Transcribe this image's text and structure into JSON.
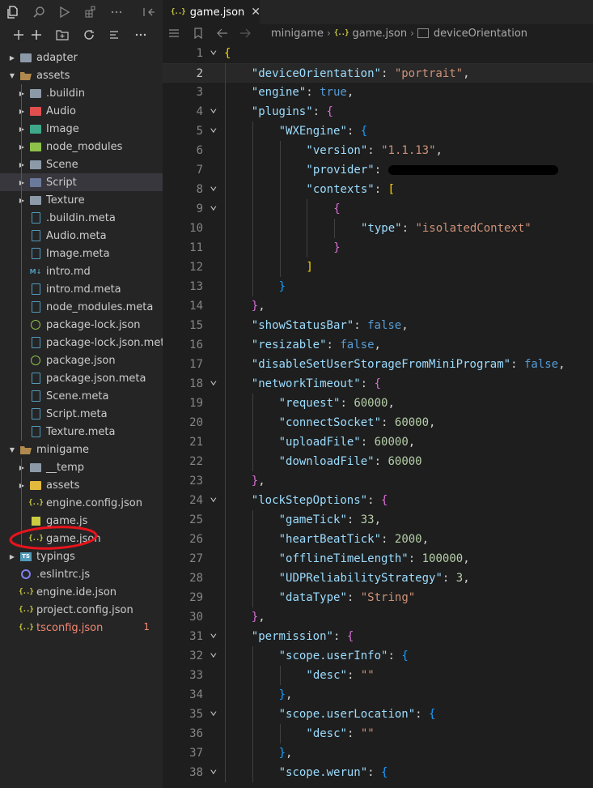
{
  "sidebar": {
    "toolbar_icons": [
      "explorer-icon",
      "search-icon",
      "debug-icon",
      "extensions-icon",
      "more-icon",
      "collapse-panel-icon"
    ],
    "action_icons": [
      "new-file-icon",
      "new-folder-icon",
      "refresh-icon",
      "collapse-all-icon",
      "more-icon"
    ],
    "tree": [
      {
        "label": "adapter",
        "type": "folder",
        "depth": 0,
        "expanded": false
      },
      {
        "label": "assets",
        "type": "folder-open",
        "depth": 0,
        "expanded": true
      },
      {
        "label": ".buildin",
        "type": "folder",
        "depth": 1,
        "expanded": false
      },
      {
        "label": "Audio",
        "type": "folder-audio",
        "depth": 1,
        "expanded": false
      },
      {
        "label": "Image",
        "type": "folder-image",
        "depth": 1,
        "expanded": false
      },
      {
        "label": "node_modules",
        "type": "folder-node",
        "depth": 1,
        "expanded": false
      },
      {
        "label": "Scene",
        "type": "folder",
        "depth": 1,
        "expanded": false
      },
      {
        "label": "Script",
        "type": "folder-script",
        "depth": 1,
        "expanded": false,
        "selected": true
      },
      {
        "label": "Texture",
        "type": "folder",
        "depth": 1,
        "expanded": false
      },
      {
        "label": ".buildin.meta",
        "type": "file",
        "depth": 1
      },
      {
        "label": "Audio.meta",
        "type": "file",
        "depth": 1
      },
      {
        "label": "Image.meta",
        "type": "file",
        "depth": 1
      },
      {
        "label": "intro.md",
        "type": "md",
        "depth": 1
      },
      {
        "label": "intro.md.meta",
        "type": "file",
        "depth": 1
      },
      {
        "label": "node_modules.meta",
        "type": "file",
        "depth": 1
      },
      {
        "label": "package-lock.json",
        "type": "node",
        "depth": 1
      },
      {
        "label": "package-lock.json.meta",
        "type": "file",
        "depth": 1
      },
      {
        "label": "package.json",
        "type": "node",
        "depth": 1
      },
      {
        "label": "package.json.meta",
        "type": "file",
        "depth": 1
      },
      {
        "label": "Scene.meta",
        "type": "file",
        "depth": 1
      },
      {
        "label": "Script.meta",
        "type": "file",
        "depth": 1
      },
      {
        "label": "Texture.meta",
        "type": "file",
        "depth": 1
      },
      {
        "label": "minigame",
        "type": "folder-open",
        "depth": 0,
        "expanded": true
      },
      {
        "label": "__temp",
        "type": "folder",
        "depth": 1,
        "expanded": false
      },
      {
        "label": "assets",
        "type": "folder-assets",
        "depth": 1,
        "expanded": false
      },
      {
        "label": "engine.config.json",
        "type": "json",
        "depth": 1
      },
      {
        "label": "game.js",
        "type": "js",
        "depth": 1
      },
      {
        "label": "game.json",
        "type": "json",
        "depth": 1,
        "annotated": true
      },
      {
        "label": "typings",
        "type": "folder-ts",
        "depth": 0,
        "expanded": false
      },
      {
        "label": ".eslintrc.js",
        "type": "eslint",
        "depth": 0
      },
      {
        "label": "engine.ide.json",
        "type": "json",
        "depth": 0
      },
      {
        "label": "project.config.json",
        "type": "json",
        "depth": 0
      },
      {
        "label": "tsconfig.json",
        "type": "json",
        "depth": 0,
        "error": true,
        "badge": "1"
      }
    ]
  },
  "editor": {
    "tab": {
      "icon": "{..}",
      "label": "game.json",
      "close": "✕"
    },
    "breadcrumbs": {
      "folder": "minigame",
      "file_icon": "{..}",
      "file": "game.json",
      "symbol": "deviceOrientation"
    },
    "current_line": 2,
    "lines": [
      {
        "n": "1",
        "fold": true,
        "indent": 0,
        "tokens": [
          {
            "t": "{",
            "c": "br1"
          }
        ]
      },
      {
        "n": "2",
        "indent": 1,
        "tokens": [
          {
            "t": "\"deviceOrientation\"",
            "c": "k"
          },
          {
            "t": ": ",
            "c": "p"
          },
          {
            "t": "\"portrait\"",
            "c": "s"
          },
          {
            "t": ",",
            "c": "p"
          }
        ]
      },
      {
        "n": "3",
        "indent": 1,
        "tokens": [
          {
            "t": "\"engine\"",
            "c": "k"
          },
          {
            "t": ": ",
            "c": "p"
          },
          {
            "t": "true",
            "c": "b"
          },
          {
            "t": ",",
            "c": "p"
          }
        ]
      },
      {
        "n": "4",
        "fold": true,
        "indent": 1,
        "tokens": [
          {
            "t": "\"plugins\"",
            "c": "k"
          },
          {
            "t": ": ",
            "c": "p"
          },
          {
            "t": "{",
            "c": "br2"
          }
        ]
      },
      {
        "n": "5",
        "fold": true,
        "indent": 2,
        "tokens": [
          {
            "t": "\"WXEngine\"",
            "c": "k"
          },
          {
            "t": ": ",
            "c": "p"
          },
          {
            "t": "{",
            "c": "br3"
          }
        ]
      },
      {
        "n": "6",
        "indent": 3,
        "tokens": [
          {
            "t": "\"version\"",
            "c": "k"
          },
          {
            "t": ": ",
            "c": "p"
          },
          {
            "t": "\"1.1.13\"",
            "c": "s"
          },
          {
            "t": ",",
            "c": "p"
          }
        ]
      },
      {
        "n": "7",
        "indent": 3,
        "tokens": [
          {
            "t": "\"provider\"",
            "c": "k"
          },
          {
            "t": ": ",
            "c": "p"
          },
          {
            "t": "",
            "c": "redact"
          }
        ]
      },
      {
        "n": "8",
        "fold": true,
        "indent": 3,
        "tokens": [
          {
            "t": "\"contexts\"",
            "c": "k"
          },
          {
            "t": ": ",
            "c": "p"
          },
          {
            "t": "[",
            "c": "br1"
          }
        ]
      },
      {
        "n": "9",
        "fold": true,
        "indent": 4,
        "tokens": [
          {
            "t": "{",
            "c": "br2"
          }
        ]
      },
      {
        "n": "10",
        "indent": 5,
        "tokens": [
          {
            "t": "\"type\"",
            "c": "k"
          },
          {
            "t": ": ",
            "c": "p"
          },
          {
            "t": "\"isolatedContext\"",
            "c": "s"
          }
        ]
      },
      {
        "n": "11",
        "indent": 4,
        "tokens": [
          {
            "t": "}",
            "c": "br2"
          }
        ]
      },
      {
        "n": "12",
        "indent": 3,
        "tokens": [
          {
            "t": "]",
            "c": "br1"
          }
        ]
      },
      {
        "n": "13",
        "indent": 2,
        "tokens": [
          {
            "t": "}",
            "c": "br3"
          }
        ]
      },
      {
        "n": "14",
        "indent": 1,
        "tokens": [
          {
            "t": "}",
            "c": "br2"
          },
          {
            "t": ",",
            "c": "p"
          }
        ]
      },
      {
        "n": "15",
        "indent": 1,
        "tokens": [
          {
            "t": "\"showStatusBar\"",
            "c": "k"
          },
          {
            "t": ": ",
            "c": "p"
          },
          {
            "t": "false",
            "c": "b"
          },
          {
            "t": ",",
            "c": "p"
          }
        ]
      },
      {
        "n": "16",
        "indent": 1,
        "tokens": [
          {
            "t": "\"resizable\"",
            "c": "k"
          },
          {
            "t": ": ",
            "c": "p"
          },
          {
            "t": "false",
            "c": "b"
          },
          {
            "t": ",",
            "c": "p"
          }
        ]
      },
      {
        "n": "17",
        "indent": 1,
        "tokens": [
          {
            "t": "\"disableSetUserStorageFromMiniProgram\"",
            "c": "k"
          },
          {
            "t": ": ",
            "c": "p"
          },
          {
            "t": "false",
            "c": "b"
          },
          {
            "t": ",",
            "c": "p"
          }
        ]
      },
      {
        "n": "18",
        "fold": true,
        "indent": 1,
        "tokens": [
          {
            "t": "\"networkTimeout\"",
            "c": "k"
          },
          {
            "t": ": ",
            "c": "p"
          },
          {
            "t": "{",
            "c": "br2"
          }
        ]
      },
      {
        "n": "19",
        "indent": 2,
        "tokens": [
          {
            "t": "\"request\"",
            "c": "k"
          },
          {
            "t": ": ",
            "c": "p"
          },
          {
            "t": "60000",
            "c": "n"
          },
          {
            "t": ",",
            "c": "p"
          }
        ]
      },
      {
        "n": "20",
        "indent": 2,
        "tokens": [
          {
            "t": "\"connectSocket\"",
            "c": "k"
          },
          {
            "t": ": ",
            "c": "p"
          },
          {
            "t": "60000",
            "c": "n"
          },
          {
            "t": ",",
            "c": "p"
          }
        ]
      },
      {
        "n": "21",
        "indent": 2,
        "tokens": [
          {
            "t": "\"uploadFile\"",
            "c": "k"
          },
          {
            "t": ": ",
            "c": "p"
          },
          {
            "t": "60000",
            "c": "n"
          },
          {
            "t": ",",
            "c": "p"
          }
        ]
      },
      {
        "n": "22",
        "indent": 2,
        "tokens": [
          {
            "t": "\"downloadFile\"",
            "c": "k"
          },
          {
            "t": ": ",
            "c": "p"
          },
          {
            "t": "60000",
            "c": "n"
          }
        ]
      },
      {
        "n": "23",
        "indent": 1,
        "tokens": [
          {
            "t": "}",
            "c": "br2"
          },
          {
            "t": ",",
            "c": "p"
          }
        ]
      },
      {
        "n": "24",
        "fold": true,
        "indent": 1,
        "tokens": [
          {
            "t": "\"lockStepOptions\"",
            "c": "k"
          },
          {
            "t": ": ",
            "c": "p"
          },
          {
            "t": "{",
            "c": "br2"
          }
        ]
      },
      {
        "n": "25",
        "indent": 2,
        "tokens": [
          {
            "t": "\"gameTick\"",
            "c": "k"
          },
          {
            "t": ": ",
            "c": "p"
          },
          {
            "t": "33",
            "c": "n"
          },
          {
            "t": ",",
            "c": "p"
          }
        ]
      },
      {
        "n": "26",
        "indent": 2,
        "tokens": [
          {
            "t": "\"heartBeatTick\"",
            "c": "k"
          },
          {
            "t": ": ",
            "c": "p"
          },
          {
            "t": "2000",
            "c": "n"
          },
          {
            "t": ",",
            "c": "p"
          }
        ]
      },
      {
        "n": "27",
        "indent": 2,
        "tokens": [
          {
            "t": "\"offlineTimeLength\"",
            "c": "k"
          },
          {
            "t": ": ",
            "c": "p"
          },
          {
            "t": "100000",
            "c": "n"
          },
          {
            "t": ",",
            "c": "p"
          }
        ]
      },
      {
        "n": "28",
        "indent": 2,
        "tokens": [
          {
            "t": "\"UDPReliabilityStrategy\"",
            "c": "k"
          },
          {
            "t": ": ",
            "c": "p"
          },
          {
            "t": "3",
            "c": "n"
          },
          {
            "t": ",",
            "c": "p"
          }
        ]
      },
      {
        "n": "29",
        "indent": 2,
        "tokens": [
          {
            "t": "\"dataType\"",
            "c": "k"
          },
          {
            "t": ": ",
            "c": "p"
          },
          {
            "t": "\"String\"",
            "c": "s"
          }
        ]
      },
      {
        "n": "30",
        "indent": 1,
        "tokens": [
          {
            "t": "}",
            "c": "br2"
          },
          {
            "t": ",",
            "c": "p"
          }
        ]
      },
      {
        "n": "31",
        "fold": true,
        "indent": 1,
        "tokens": [
          {
            "t": "\"permission\"",
            "c": "k"
          },
          {
            "t": ": ",
            "c": "p"
          },
          {
            "t": "{",
            "c": "br2"
          }
        ]
      },
      {
        "n": "32",
        "fold": true,
        "indent": 2,
        "tokens": [
          {
            "t": "\"scope.userInfo\"",
            "c": "k"
          },
          {
            "t": ": ",
            "c": "p"
          },
          {
            "t": "{",
            "c": "br3"
          }
        ]
      },
      {
        "n": "33",
        "indent": 3,
        "tokens": [
          {
            "t": "\"desc\"",
            "c": "k"
          },
          {
            "t": ": ",
            "c": "p"
          },
          {
            "t": "\"\"",
            "c": "s"
          }
        ]
      },
      {
        "n": "34",
        "indent": 2,
        "tokens": [
          {
            "t": "}",
            "c": "br3"
          },
          {
            "t": ",",
            "c": "p"
          }
        ]
      },
      {
        "n": "35",
        "fold": true,
        "indent": 2,
        "tokens": [
          {
            "t": "\"scope.userLocation\"",
            "c": "k"
          },
          {
            "t": ": ",
            "c": "p"
          },
          {
            "t": "{",
            "c": "br3"
          }
        ]
      },
      {
        "n": "36",
        "indent": 3,
        "tokens": [
          {
            "t": "\"desc\"",
            "c": "k"
          },
          {
            "t": ": ",
            "c": "p"
          },
          {
            "t": "\"\"",
            "c": "s"
          }
        ]
      },
      {
        "n": "37",
        "indent": 2,
        "tokens": [
          {
            "t": "}",
            "c": "br3"
          },
          {
            "t": ",",
            "c": "p"
          }
        ]
      },
      {
        "n": "38",
        "fold": true,
        "indent": 2,
        "tokens": [
          {
            "t": "\"scope.werun\"",
            "c": "k"
          },
          {
            "t": ": ",
            "c": "p"
          },
          {
            "t": "{",
            "c": "br3"
          }
        ]
      }
    ]
  },
  "colors": {
    "annotation": "#e8141c",
    "accent": "#007acc"
  }
}
